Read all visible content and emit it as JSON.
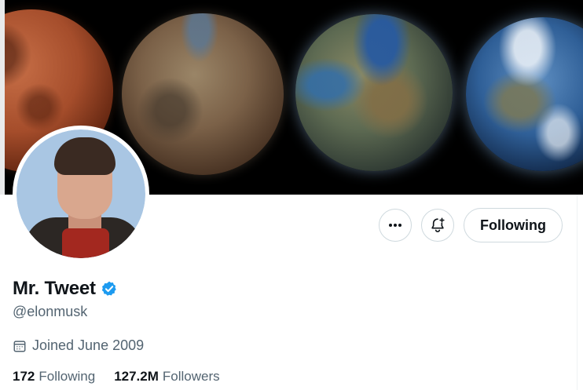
{
  "profile": {
    "display_name": "Mr. Tweet",
    "handle": "@elonmusk",
    "verified": true,
    "joined": "Joined June 2009",
    "following_count": "172",
    "following_label": "Following",
    "followers_count": "127.2M",
    "followers_label": "Followers"
  },
  "actions": {
    "more_icon": "more-options-icon",
    "bell_icon": "notification-bell-icon",
    "follow_label": "Following"
  },
  "colors": {
    "verified_badge": "#1d9bf0",
    "secondary_text": "#536471",
    "primary_text": "#0f1419"
  }
}
